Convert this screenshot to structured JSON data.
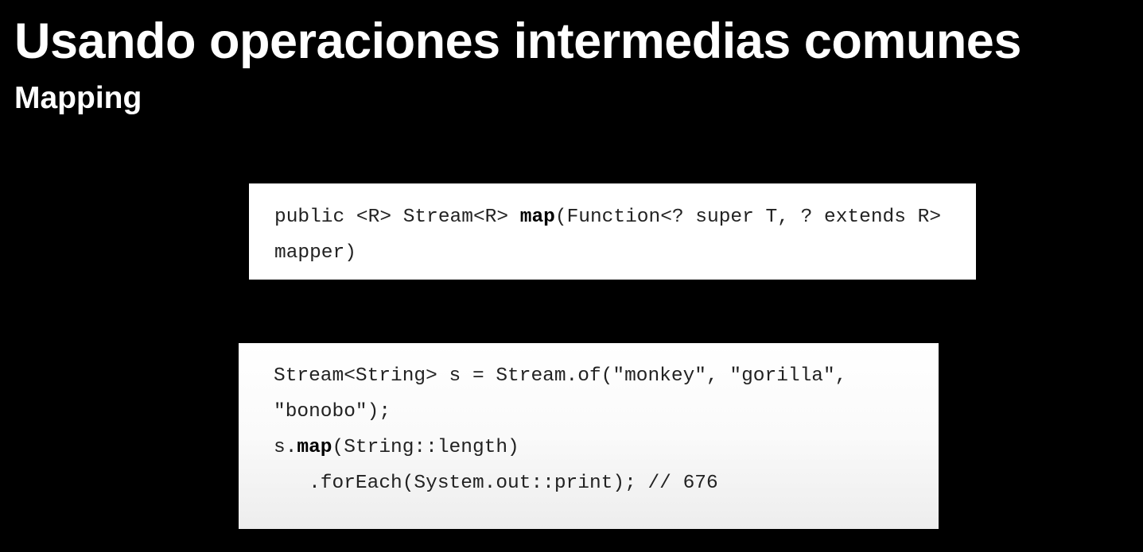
{
  "slide": {
    "title": "Usando operaciones intermedias comunes",
    "subtitle": "Mapping"
  },
  "code_blocks": [
    {
      "lines": [
        [
          {
            "text": "public <R> Stream<R> ",
            "bold": false
          },
          {
            "text": "map",
            "bold": true
          },
          {
            "text": "(Function<? super T, ? extends R>",
            "bold": false
          }
        ],
        [
          {
            "text": "mapper)",
            "bold": false
          }
        ]
      ]
    },
    {
      "lines": [
        [
          {
            "text": "Stream<String> s = Stream.of(\"monkey\", \"gorilla\",",
            "bold": false
          }
        ],
        [
          {
            "text": "\"bonobo\");",
            "bold": false
          }
        ],
        [
          {
            "text": "s.",
            "bold": false
          },
          {
            "text": "map",
            "bold": true
          },
          {
            "text": "(String::length)",
            "bold": false
          }
        ],
        [
          {
            "text": "   .forEach(System.out::print); // 676",
            "bold": false
          }
        ]
      ]
    }
  ]
}
